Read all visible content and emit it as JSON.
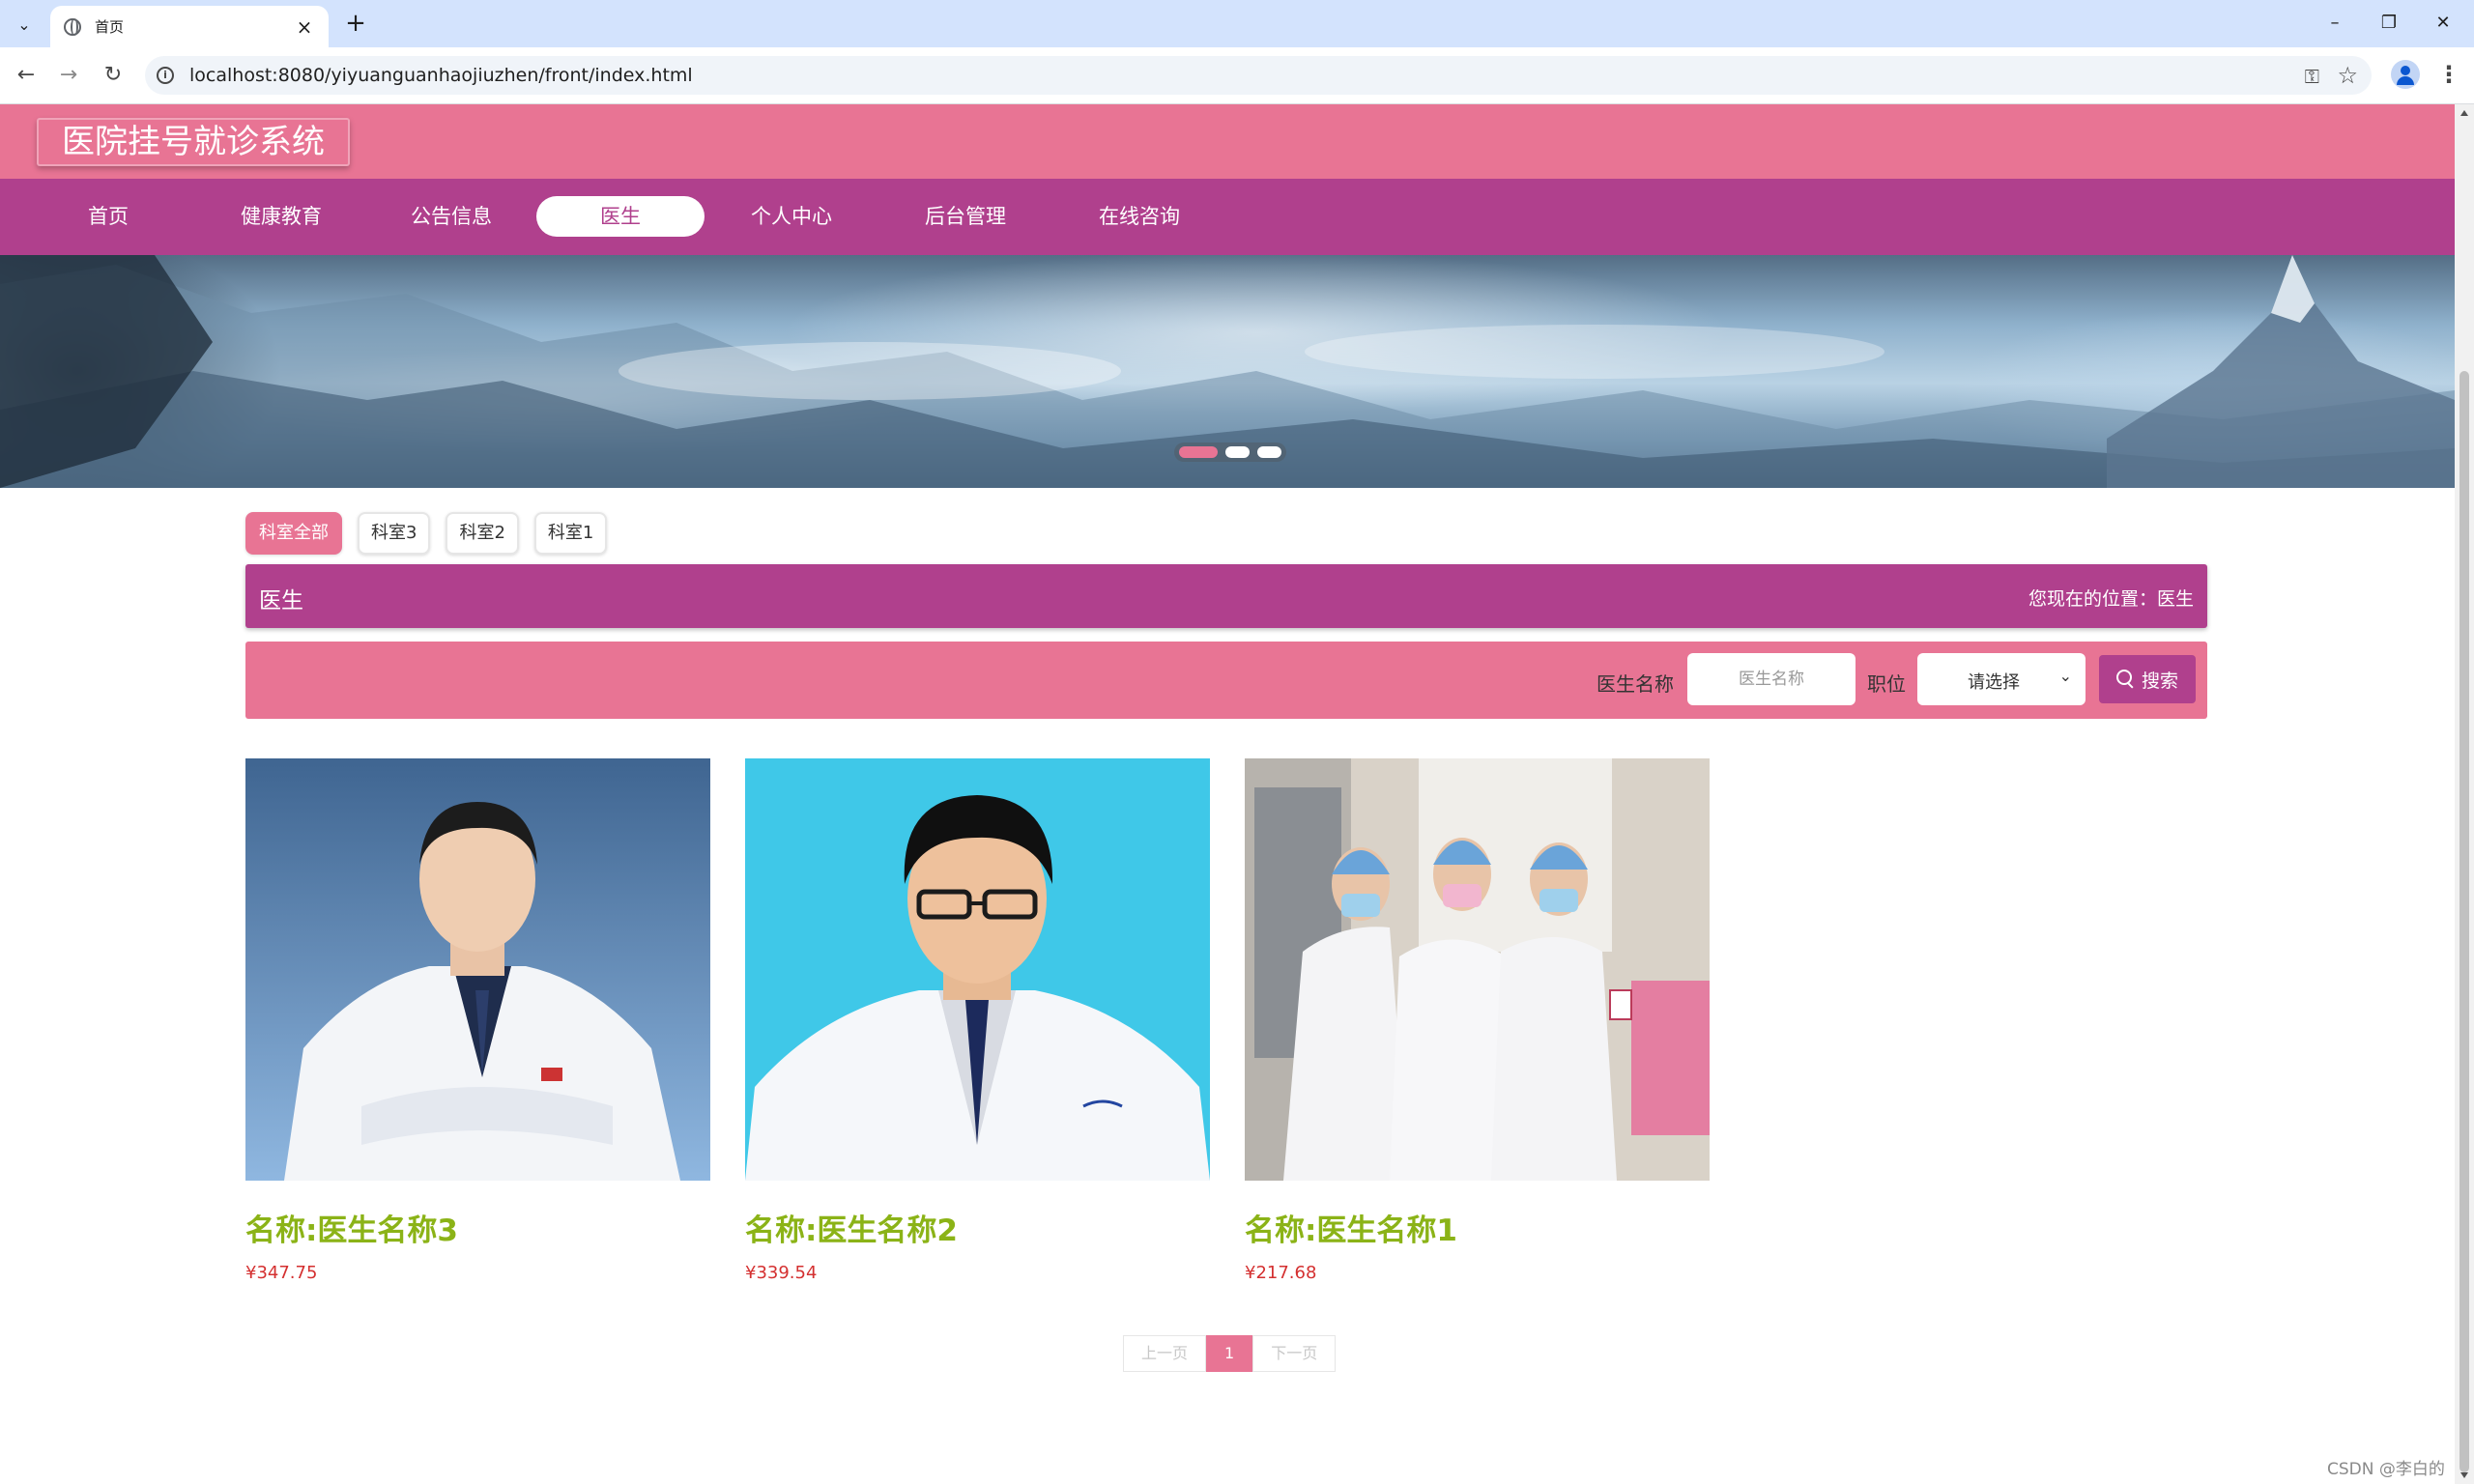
{
  "browser": {
    "tab_title": "首页",
    "url": "localhost:8080/yiyuanguanhaojiuzhen/front/index.html"
  },
  "site": {
    "title": "医院挂号就诊系统",
    "nav": [
      {
        "label": "首页",
        "active": false
      },
      {
        "label": "健康教育",
        "active": false
      },
      {
        "label": "公告信息",
        "active": false
      },
      {
        "label": "医生",
        "active": true
      },
      {
        "label": "个人中心",
        "active": false
      },
      {
        "label": "后台管理",
        "active": false
      },
      {
        "label": "在线咨询",
        "active": false
      }
    ],
    "banner_slides": 3,
    "banner_active": 1
  },
  "categories": [
    {
      "label": "科室全部",
      "active": true
    },
    {
      "label": "科室3",
      "active": false
    },
    {
      "label": "科室2",
      "active": false
    },
    {
      "label": "科室1",
      "active": false
    }
  ],
  "section": {
    "title": "医生",
    "location": "您现在的位置：医生"
  },
  "search": {
    "name_label": "医生名称",
    "name_placeholder": "医生名称",
    "position_label": "职位",
    "position_selected": "请选择",
    "button_label": "搜索"
  },
  "doctors": [
    {
      "name": "名称:医生名称3",
      "price": "¥347.75"
    },
    {
      "name": "名称:医生名称2",
      "price": "¥339.54"
    },
    {
      "name": "名称:医生名称1",
      "price": "¥217.68"
    }
  ],
  "pager": {
    "prev": "上一页",
    "current": "1",
    "next": "下一页"
  },
  "watermark": "CSDN @李白的粉",
  "colors": {
    "header_pink": "#e87494",
    "nav_purple": "#b0408d",
    "name_green": "#8bb317",
    "price_red": "#d43030"
  }
}
